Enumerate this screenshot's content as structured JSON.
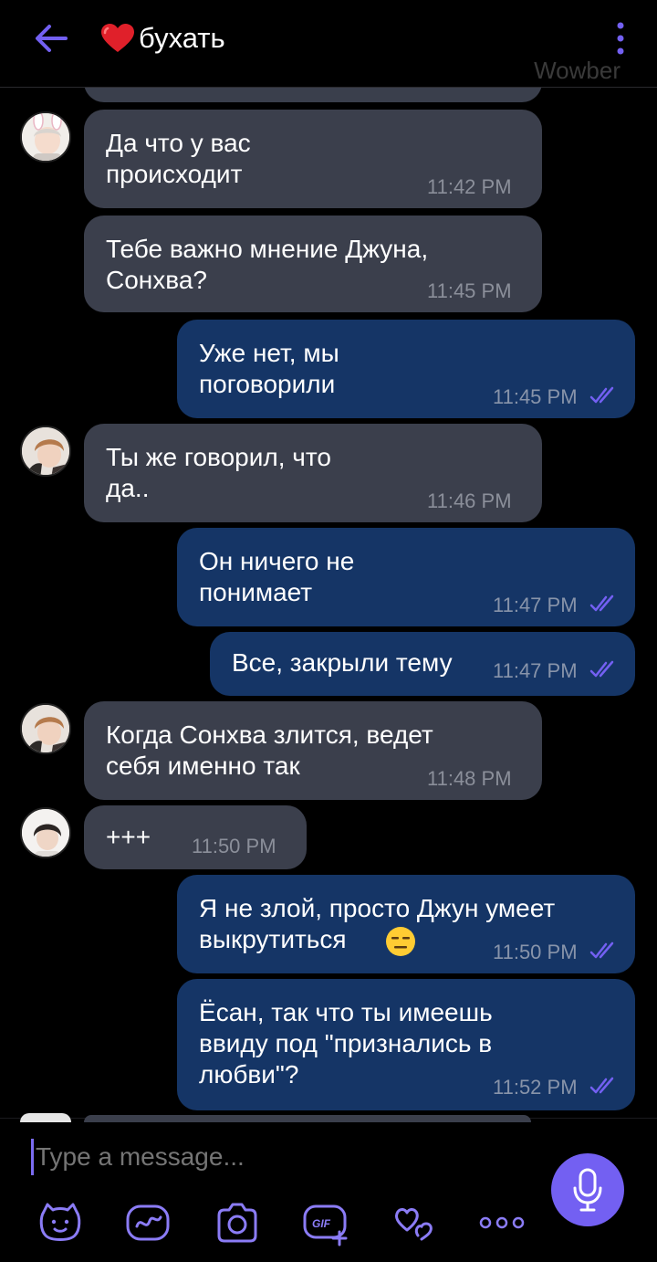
{
  "header": {
    "title": "бухать",
    "watermark": "Wowber"
  },
  "colors": {
    "accent": "#7360f2",
    "incoming_bubble": "#3b3f4c",
    "outgoing_bubble": "#153566",
    "heart": "#e0202a"
  },
  "messages": [
    {
      "dir": "in",
      "avatar": "avatar-bunny-ears",
      "text": "Да что у вас\nпроисходит",
      "time": "11:42 PM"
    },
    {
      "dir": "in",
      "avatar": "",
      "text": "Тебе важно мнение Джуна,\nСонхва?",
      "time": "11:45 PM"
    },
    {
      "dir": "out",
      "text": "Уже нет, мы\nпоговорили",
      "time": "11:45 PM",
      "status": "read"
    },
    {
      "dir": "in",
      "avatar": "avatar-brown-hair",
      "text": "Ты же говорил, что\nда..",
      "time": "11:46 PM"
    },
    {
      "dir": "out",
      "text": "Он ничего не\nпонимает",
      "time": "11:47 PM",
      "status": "read"
    },
    {
      "dir": "out",
      "text": "Все, закрыли тему",
      "time": "11:47 PM",
      "status": "read"
    },
    {
      "dir": "in",
      "avatar": "avatar-brown-hair",
      "text": "Когда Сонхва злится, ведет\nсебя именно так",
      "time": "11:48 PM"
    },
    {
      "dir": "in",
      "avatar": "avatar-dark-hair",
      "text": "+++",
      "time": "11:50 PM"
    },
    {
      "dir": "out",
      "text": "Я не злой, просто Джун умеет\nвыкрутиться",
      "emoji": "expressionless-face-emoji",
      "time": "11:50 PM",
      "status": "read"
    },
    {
      "dir": "out",
      "text": "Ёсан, так что ты имеешь\nввиду под \"признались в\nлюбви\"?",
      "time": "11:52 PM",
      "status": "read"
    }
  ],
  "composer": {
    "placeholder": "Type a message...",
    "tools": [
      "sticker-icon",
      "doodle-icon",
      "camera-icon",
      "gif-icon",
      "hearts-icon",
      "more-icon"
    ],
    "mic_icon": "microphone-icon"
  }
}
